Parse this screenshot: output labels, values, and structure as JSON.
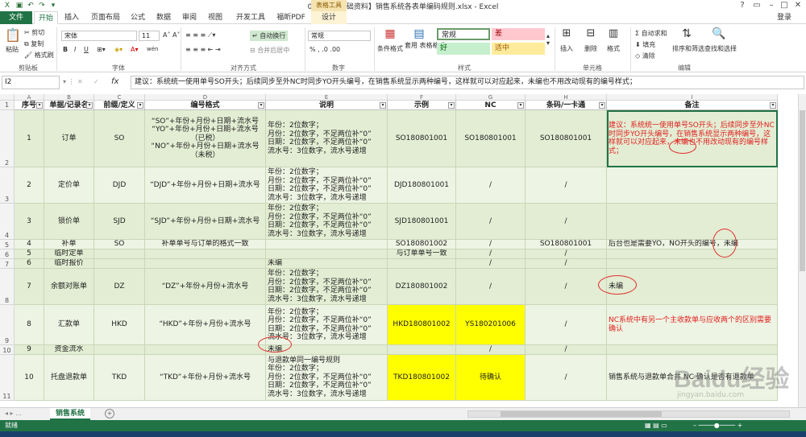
{
  "window": {
    "title": "04_01 【基础资料】销售系统各表单编码规则.xlsx - Excel",
    "context_tab": "表格工具",
    "login": "登录"
  },
  "ribbon_tabs": [
    "文件",
    "开始",
    "插入",
    "页面布局",
    "公式",
    "数据",
    "审阅",
    "视图",
    "开发工具",
    "福昕PDF",
    "设计"
  ],
  "ribbon": {
    "clipboard": {
      "paste": "粘贴",
      "cut": "剪切",
      "copy": "复制",
      "format_painter": "格式刷",
      "label": "剪贴板"
    },
    "font": {
      "name": "宋体",
      "size": "11",
      "label": "字体",
      "bold": "B",
      "italic": "I",
      "underline": "U",
      "wen": "wén"
    },
    "alignment": {
      "wrap": "自动换行",
      "merge": "合并后居中",
      "label": "对齐方式"
    },
    "number": {
      "format": "常规",
      "label": "数字"
    },
    "styles": {
      "cond": "条件格式",
      "table": "套用\n表格格式",
      "normal": "常规",
      "bad": "差",
      "good": "好",
      "neutral": "适中",
      "label": "样式"
    },
    "cells": {
      "insert": "插入",
      "delete": "删除",
      "format": "格式",
      "label": "单元格"
    },
    "editing": {
      "autosum": "自动求和",
      "fill": "填充",
      "clear": "清除",
      "sort": "排序和筛选",
      "find": "查找和选择",
      "label": "编辑"
    }
  },
  "formula_bar": {
    "name_box": "I2",
    "fx": "fx",
    "content": "建议：系统统一使用单号SO开头；后续同步至外NC时同步YO开头编号，在销售系统显示两种编号，这样就可以对应起来，未编也不用改动现有的编号样式；"
  },
  "columns": [
    {
      "letter": "A",
      "header": "序号"
    },
    {
      "letter": "B",
      "header": "单据/记录名"
    },
    {
      "letter": "C",
      "header": "前缀/定义"
    },
    {
      "letter": "D",
      "header": "编号格式"
    },
    {
      "letter": "E",
      "header": "说明"
    },
    {
      "letter": "F",
      "header": "示例"
    },
    {
      "letter": "G",
      "header": "NC"
    },
    {
      "letter": "H",
      "header": "条码/一卡通"
    },
    {
      "letter": "I",
      "header": "备注"
    }
  ],
  "header_row_num": "1",
  "rows": [
    {
      "num": "2",
      "a": "1",
      "b": "订单",
      "c": "SO",
      "d": "“SO”+年份+月份+日期+流水号\n“YO”+年份+月份+日期+流水号（已税）\n“NO”+年份+月份+日期+流水号（未税）",
      "e": "年份：2位数字；\n月份：2位数字，不足两位补“0”\n日期：2位数字，不足两位补“0”\n流水号：3位数字，流水号递增",
      "f": "SO180801001",
      "g": "SO180801001",
      "h": "SO180801001",
      "i": "建议：系统统一使用单号SO开头；后续同步至外NC时同步YO开头编号，在销售系统显示两种编号，这样就可以对应起来，未编也不用改动现有的编号样式；"
    },
    {
      "num": "3",
      "a": "2",
      "b": "定价单",
      "c": "DJD",
      "d": "“DJD”+年份+月份+日期+流水号",
      "e": "年份：2位数字；\n月份：2位数字，不足两位补“0”\n日期：2位数字，不足两位补“0”\n流水号：3位数字，流水号递增",
      "f": "DJD180801001",
      "g": "/",
      "h": "/",
      "i": ""
    },
    {
      "num": "4",
      "a": "3",
      "b": "锁价单",
      "c": "SJD",
      "d": "“SJD”+年份+月份+日期+流水号",
      "e": "年份：2位数字；\n月份：2位数字，不足两位补“0”\n日期：2位数字，不足两位补“0”\n流水号：3位数字，流水号递增",
      "f": "SJD180801001",
      "g": "/",
      "h": "/",
      "i": ""
    },
    {
      "num": "5",
      "a": "4",
      "b": "补单",
      "c": "SO",
      "d": "补单单号与订单的格式一致",
      "e": "",
      "f": "SO180801002",
      "g": "/",
      "h": "SO180801001",
      "i": "后台也是需要YO，NO开头的编号，未编"
    },
    {
      "num": "6",
      "a": "5",
      "b": "临时定单",
      "c": "",
      "d": "",
      "e": "",
      "f": "与订单单号一致",
      "g": "/",
      "h": "/",
      "i": ""
    },
    {
      "num": "7",
      "a": "6",
      "b": "临时报价",
      "c": "",
      "d": "",
      "e": "未编",
      "f": "",
      "g": "/",
      "h": "/",
      "i": ""
    },
    {
      "num": "8",
      "a": "7",
      "b": "余额对账单",
      "c": "DZ",
      "d": "“DZ”+年份+月份+流水号",
      "e": "年份：2位数字；\n月份：2位数字，不足两位补“0”\n日期：2位数字，不足两位补“0”\n流水号：3位数字，流水号递增",
      "f": "DZ180801002",
      "g": "/",
      "h": "/",
      "i": "未编"
    },
    {
      "num": "9",
      "a": "8",
      "b": "汇款单",
      "c": "HKD",
      "d": "“HKD”+年份+月份+流水号",
      "e": "年份：2位数字；\n月份：2位数字，不足两位补“0”\n日期：2位数字，不足两位补“0”\n流水号：3位数字，流水号递增",
      "f": "HKD180801002",
      "g": "YS180201006",
      "h": "/",
      "i": "NC系统中有另一个主收款单与应收两个的区别需要确认"
    },
    {
      "num": "10",
      "a": "9",
      "b": "资金流水",
      "c": "",
      "d": "",
      "e": "未编",
      "f": "",
      "g": "/",
      "h": "/",
      "i": ""
    },
    {
      "num": "11",
      "a": "10",
      "b": "托盘退款单",
      "c": "TKD",
      "d": "“TKD”+年份+月份+流水号",
      "e": "与退款单同一编号规则\n年份：2位数字；\n月份：2位数字，不足两位补“0”\n日期：2位数字，不足两位补“0”\n流水号：3位数字，流水号递增",
      "f": "TKD180801002",
      "g": "待确认",
      "h": "/",
      "i": "销售系统与退款单合并 NC 确认是否有退款单"
    }
  ],
  "sheet_tab": "销售系统",
  "status": {
    "left": "就绪"
  },
  "watermark": {
    "brand": "Baidu经验",
    "url": "jingyan.baidu.com"
  },
  "colors": {
    "excel_green": "#217346",
    "row_fill": "#eef4e3",
    "yellow": "#ffff00",
    "note_red": "#e02020"
  }
}
